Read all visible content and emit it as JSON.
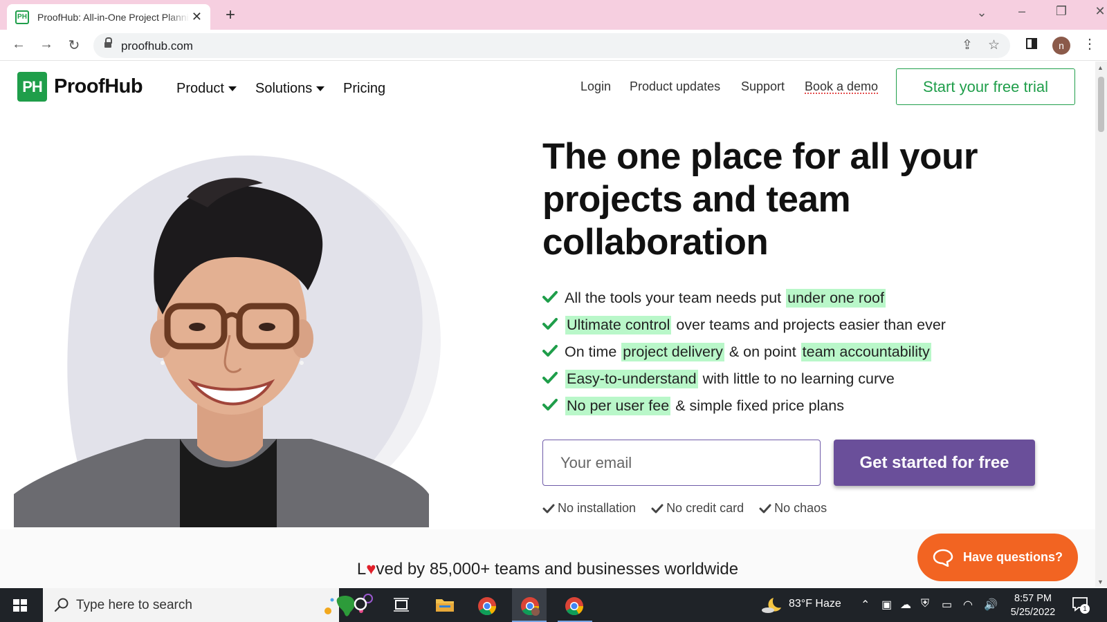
{
  "browser": {
    "tab_title": "ProofHub: All-in-One Project Planning Software",
    "favicon_text": "PH",
    "url": "proofhub.com",
    "profile_initial": "n"
  },
  "header": {
    "logo_mark": "PH",
    "logo_text": "ProofHub",
    "nav": {
      "product": "Product",
      "solutions": "Solutions",
      "pricing": "Pricing"
    },
    "links": {
      "login": "Login",
      "updates": "Product updates",
      "support": "Support",
      "demo": "Book a demo"
    },
    "trial_button": "Start your free trial"
  },
  "hero": {
    "headline_1": "The one place for all your",
    "headline_2": "projects and team",
    "headline_3": "collaboration",
    "features": [
      {
        "t1": "All the tools your team needs put",
        "h1": "under one roof"
      },
      {
        "h1": "Ultimate control",
        "t1": "over teams and projects easier than ever"
      },
      {
        "t1": "On time",
        "h1": "project delivery",
        "t2": "& on point",
        "h2": "team accountability"
      },
      {
        "h1": "Easy-to-understand",
        "t1": "with little to no learning curve"
      },
      {
        "h1": "No per user fee",
        "t1": "& simple fixed price plans"
      }
    ],
    "email_placeholder": "Your email",
    "cta": "Get started for free",
    "notes": [
      "No installation",
      "No credit card",
      "No chaos"
    ]
  },
  "loved": {
    "prefix": "L",
    "suffix": "ved by 85,000+ teams and businesses worldwide"
  },
  "chat": {
    "label": "Have questions?"
  },
  "taskbar": {
    "search_placeholder": "Type here to search",
    "weather": "83°F  Haze",
    "time": "8:57 PM",
    "date": "5/25/2022",
    "notifications": "1"
  },
  "colors": {
    "brand_green": "#1f9e4a",
    "highlight": "#b9f7c9",
    "cta_purple": "#6a4f9a",
    "chat_orange": "#f26422"
  }
}
